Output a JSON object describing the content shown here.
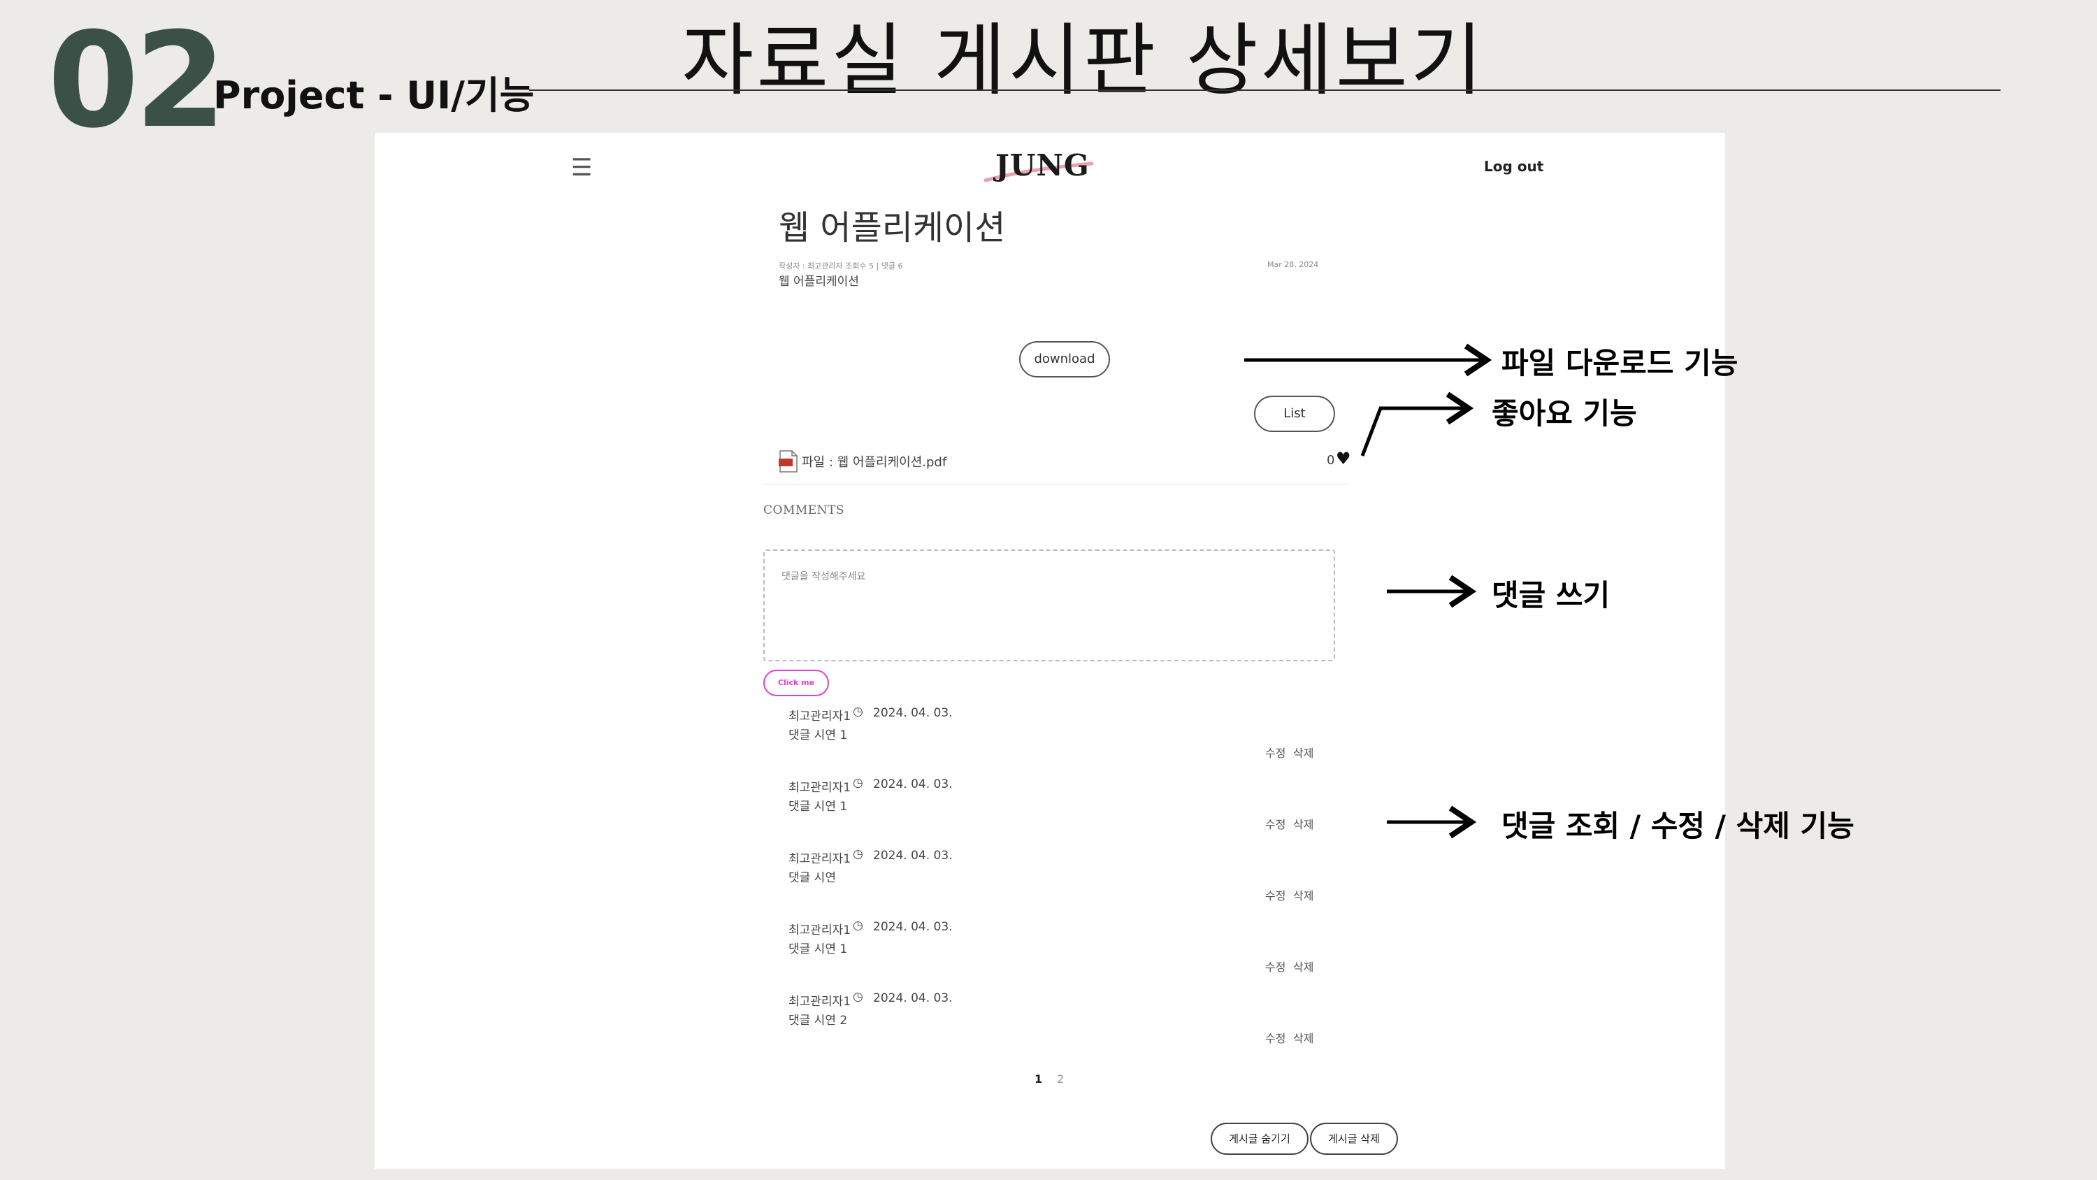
{
  "slide": {
    "number": "02",
    "subtitle": "Project - UI/기능",
    "title": "자료실 게시판 상세보기"
  },
  "header": {
    "menu_icon": "hamburger-menu-icon",
    "logo": "JUNG",
    "logout_label": "Log out"
  },
  "post": {
    "title": "웹 어플리케이션",
    "meta": "작성자 : 최고관리자    조회수 5 | 댓글 6",
    "date": "Mar 28, 2024",
    "body": "웹 어플리케이션",
    "download_label": "download",
    "list_label": "List",
    "file_label": "파일 : 웹 어플리케이션.pdf",
    "like_count": "0",
    "heart_glyph": "♥"
  },
  "comments": {
    "heading": "COMMENTS",
    "placeholder": "댓글을 작성해주세요",
    "submit_label": "Click me",
    "clock_glyph": "◷",
    "items": [
      {
        "author": "최고관리자1",
        "date": "2024. 04. 03.",
        "text": "댓글 시연 1",
        "edit": "수정",
        "delete": "삭제"
      },
      {
        "author": "최고관리자1",
        "date": "2024. 04. 03.",
        "text": "댓글 시연 1",
        "edit": "수정",
        "delete": "삭제"
      },
      {
        "author": "최고관리자1",
        "date": "2024. 04. 03.",
        "text": "댓글 시연",
        "edit": "수정",
        "delete": "삭제"
      },
      {
        "author": "최고관리자1",
        "date": "2024. 04. 03.",
        "text": "댓글 시연 1",
        "edit": "수정",
        "delete": "삭제"
      },
      {
        "author": "최고관리자1",
        "date": "2024. 04. 03.",
        "text": "댓글 시연 2",
        "edit": "수정",
        "delete": "삭제"
      }
    ]
  },
  "pagination": {
    "pages": [
      "1",
      "2"
    ],
    "current": "1"
  },
  "footer_buttons": {
    "hide_label": "게시글 숨기기",
    "delete_label": "게시글 삭제"
  },
  "annotations": {
    "download": "파일 다운로드 기능",
    "like": "좋아요 기능",
    "comment_write": "댓글 쓰기",
    "comment_manage": "댓글 조회 / 수정 / 삭제 기능"
  },
  "colors": {
    "slide_bg": "#edebe7",
    "slide_number": "#3b5146",
    "submit_accent": "#e040d0"
  }
}
